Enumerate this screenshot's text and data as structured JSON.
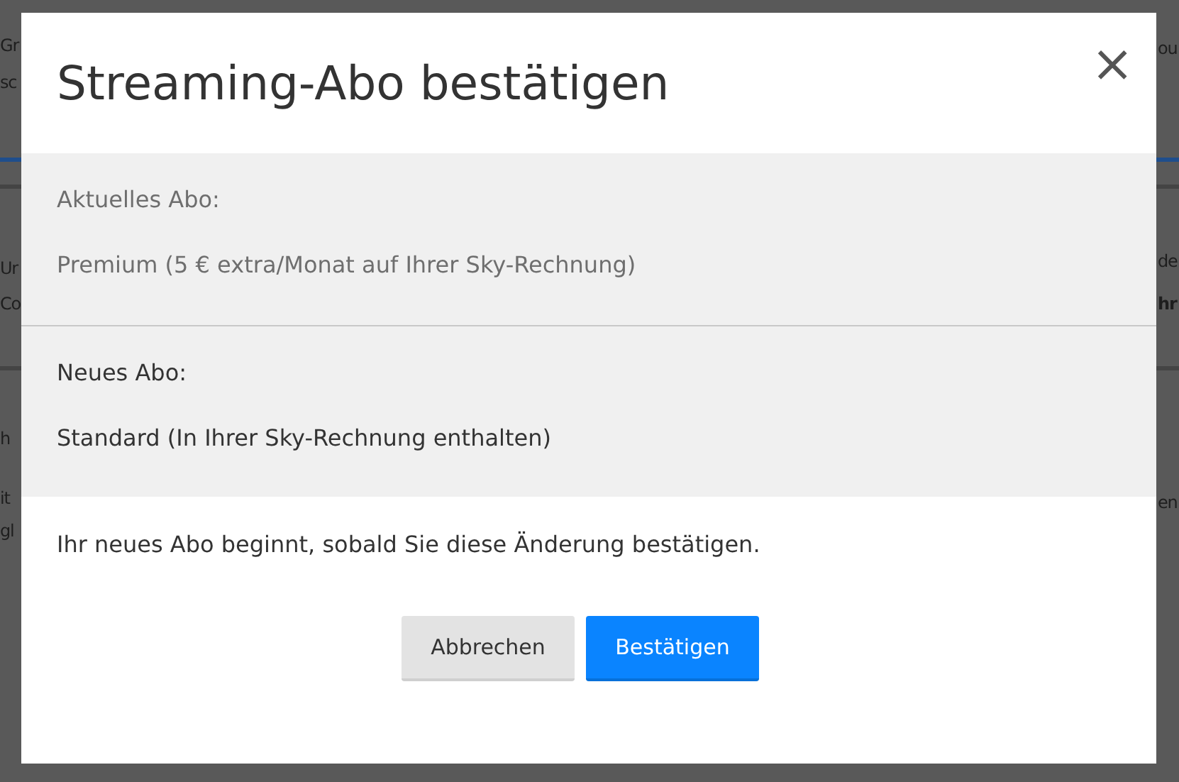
{
  "backdrop": {
    "left_fragments": [
      {
        "text": "Gr",
        "bold": false
      },
      {
        "text": "sc",
        "bold": false
      },
      {
        "text": "Ur",
        "bold": false
      },
      {
        "text": "Co",
        "bold": false
      },
      {
        "text": "h",
        "bold": false
      },
      {
        "text": "it",
        "bold": false
      },
      {
        "text": "gl",
        "bold": false
      }
    ],
    "right_fragments": [
      {
        "text": "ou",
        "bold": false
      },
      {
        "text": "de",
        "bold": false
      },
      {
        "text": "hr",
        "bold": true
      },
      {
        "text": "en",
        "bold": false
      }
    ]
  },
  "modal": {
    "title": "Streaming-Abo bestätigen",
    "close": "×",
    "current": {
      "label": "Aktuelles Abo:",
      "value": "Premium (5 € extra/Monat auf Ihrer Sky-Rechnung)"
    },
    "new": {
      "label": "Neues Abo:",
      "value": "Standard (In Ihrer Sky-Rechnung enthalten)"
    },
    "note": "Ihr neues Abo beginnt, sobald Sie diese Änderung bestätigen.",
    "buttons": [
      {
        "label": "Abbrechen",
        "kind": "secondary"
      },
      {
        "label": "Bestätigen",
        "kind": "primary"
      }
    ]
  }
}
